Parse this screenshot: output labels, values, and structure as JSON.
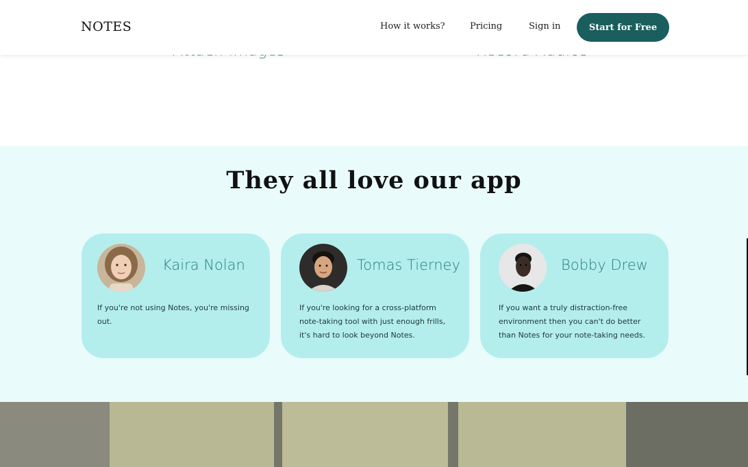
{
  "header": {
    "logo": "NOTES",
    "nav": {
      "how_it_works": "How it works?",
      "pricing": "Pricing",
      "sign_in": "Sign in"
    },
    "cta_label": "Start for Free"
  },
  "features": {
    "left_label": "Attach images",
    "right_label": "Record Audios"
  },
  "testimonials": {
    "title": "They all love our app",
    "cards": [
      {
        "name": "Kaira Nolan",
        "quote": "If you're not using Notes, you're missing out."
      },
      {
        "name": "Tomas Tierney",
        "quote": "If you're looking for a cross-platform note-taking tool with just enough frills, it's hard to look beyond Notes."
      },
      {
        "name": "Bobby Drew",
        "quote": "If you want a truly distraction-free environment then you can't do better than Notes for your note-taking needs."
      }
    ]
  },
  "colors": {
    "brand": "#1a5e5e",
    "section_bg": "#e9fbfb",
    "card_bg": "#b3eeed",
    "accent_text": "#2a7d7c"
  },
  "icons": [
    "avatar-kaira-nolan",
    "avatar-tomas-tierney",
    "avatar-bobby-drew"
  ]
}
